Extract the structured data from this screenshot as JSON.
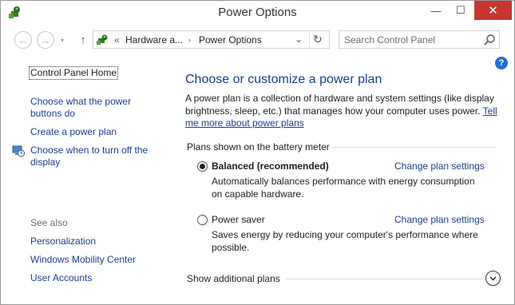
{
  "window": {
    "title": "Power Options",
    "buttons": {
      "minimize": "—",
      "maximize": "☐",
      "close": "✕"
    }
  },
  "nav": {
    "back": "←",
    "forward": "→",
    "recent": "▾",
    "up": "↑",
    "address": {
      "overflow": "«",
      "crumbs": [
        "Hardware a...",
        "Power Options"
      ],
      "separator": "›",
      "dropdown": "⌄",
      "refresh": "↻"
    },
    "search": {
      "placeholder": "Search Control Panel",
      "value": ""
    }
  },
  "help": {
    "label": "?"
  },
  "sidebar": {
    "home": "Control Panel Home",
    "links": [
      "Choose what the power buttons do",
      "Create a power plan",
      "Choose when to turn off the display"
    ],
    "see_also_label": "See also",
    "see_also": [
      "Personalization",
      "Windows Mobility Center",
      "User Accounts"
    ]
  },
  "main": {
    "heading": "Choose or customize a power plan",
    "intro_text": "A power plan is a collection of hardware and system settings (like display brightness, sleep, etc.) that manages how your computer uses power. ",
    "intro_link": "Tell me more about power plans",
    "group_label": "Plans shown on the battery meter",
    "plans": [
      {
        "name": "Balanced (recommended)",
        "selected": true,
        "description": "Automatically balances performance with energy consumption on capable hardware.",
        "action": "Change plan settings"
      },
      {
        "name": "Power saver",
        "selected": false,
        "description": "Saves energy by reducing your computer's performance where possible.",
        "action": "Change plan settings"
      }
    ],
    "show_more": "Show additional plans"
  },
  "colors": {
    "link": "#1a3e8c",
    "close_button": "#c7372f",
    "help_icon": "#1e6fd0",
    "text": "#1e1e1e"
  }
}
